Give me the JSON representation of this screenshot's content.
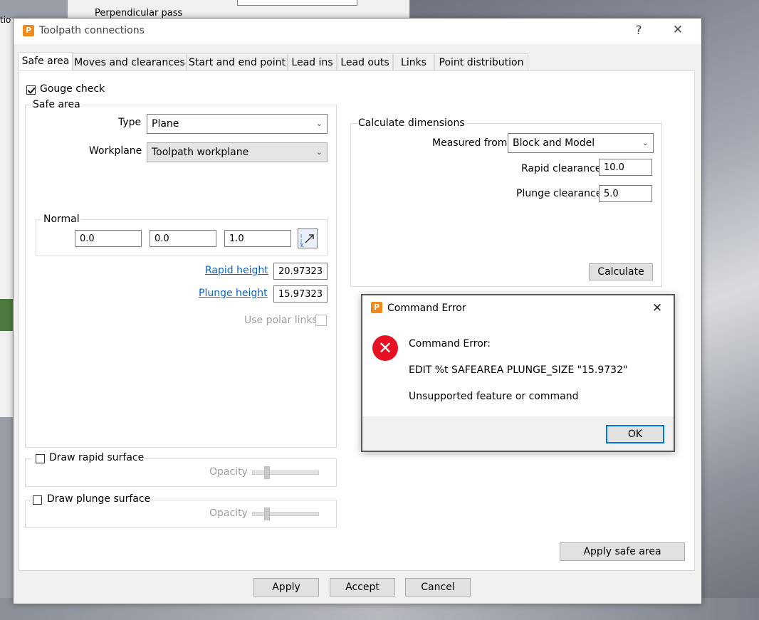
{
  "background": {
    "partial_label": "Perpendicular pass",
    "edge_label": "tio"
  },
  "dialog": {
    "title": "Toolpath connections",
    "help": "?",
    "close": "✕",
    "tabs": [
      {
        "label": "Safe area",
        "active": true
      },
      {
        "label": "Moves and clearances"
      },
      {
        "label": "Start and end point"
      },
      {
        "label": "Lead ins"
      },
      {
        "label": "Lead outs"
      },
      {
        "label": "Links"
      },
      {
        "label": "Point distribution"
      }
    ],
    "gouge_check": {
      "label": "Gouge check",
      "checked": true
    },
    "safe_area": {
      "legend": "Safe area",
      "type_label": "Type",
      "type_value": "Plane",
      "workplane_label": "Workplane",
      "workplane_value": "Toolpath workplane",
      "normal": {
        "legend": "Normal",
        "x": "0.0",
        "y": "0.0",
        "z": "1.0",
        "icon": "direction-picker-icon"
      },
      "rapid_height_label": "Rapid height",
      "rapid_height_value": "20.97323",
      "plunge_height_label": "Plunge height",
      "plunge_height_value": "15.97323",
      "polar_links_label": "Use polar links"
    },
    "calc_dimensions": {
      "legend": "Calculate dimensions",
      "measured_from_label": "Measured from",
      "measured_from_value": "Block and Model",
      "rapid_clearance_label": "Rapid clearance",
      "rapid_clearance_value": "10.0",
      "plunge_clearance_label": "Plunge clearance",
      "plunge_clearance_value": "5.0",
      "calculate_label": "Calculate"
    },
    "draw_rapid": {
      "label": "Draw rapid surface",
      "opacity_label": "Opacity"
    },
    "draw_plunge": {
      "label": "Draw plunge surface",
      "opacity_label": "Opacity"
    },
    "apply_safe_area": "Apply safe area",
    "footer": {
      "apply": "Apply",
      "accept": "Accept",
      "cancel": "Cancel"
    }
  },
  "error_dialog": {
    "title": "Command Error",
    "close": "✕",
    "icon": "error-x-icon",
    "heading": "Command Error:",
    "command": "EDIT %t SAFEAREA PLUNGE_SIZE  \"15.9732\"",
    "message": "Unsupported feature or command",
    "ok": "OK"
  }
}
